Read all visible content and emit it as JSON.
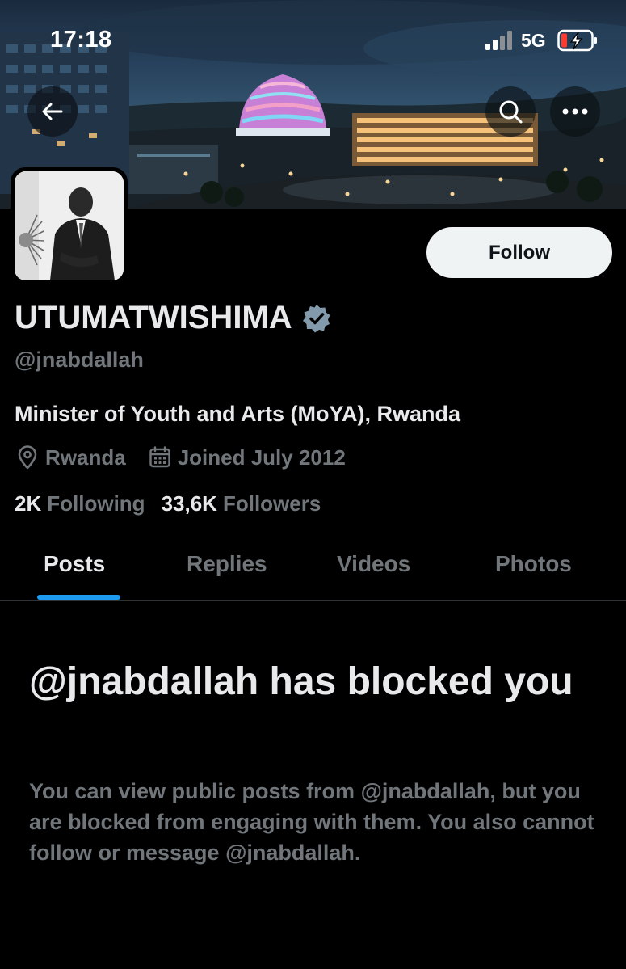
{
  "status_bar": {
    "time": "17:18",
    "network": "5G",
    "icons": [
      "signal-icon",
      "battery-charging-icon"
    ]
  },
  "nav": {
    "icons": [
      "back-arrow-icon",
      "search-icon",
      "more-icon"
    ]
  },
  "profile": {
    "display_name": "UTUMATWISHIMA",
    "verified": true,
    "handle": "@jnabdallah",
    "bio": "Minister of Youth and Arts (MoYA), Rwanda",
    "location": "Rwanda",
    "joined": "Joined July 2012",
    "following_count": "2K",
    "following_label": "Following",
    "followers_count": "33,6K",
    "followers_label": "Followers",
    "follow_label": "Follow"
  },
  "tabs": [
    {
      "label": "Posts",
      "active": true
    },
    {
      "label": "Replies",
      "active": false
    },
    {
      "label": "Videos",
      "active": false
    },
    {
      "label": "Photos",
      "active": false
    }
  ],
  "blocked": {
    "title": "@jnabdallah has blocked you",
    "body": "You can view public posts from @jnabdallah, but you are blocked from engaging with them. You also cannot follow or message @jnabdallah."
  },
  "colors": {
    "background": "#000000",
    "primary_text": "#e7e9ea",
    "secondary_text": "#71767b",
    "accent": "#1d9bf0",
    "follow_button": "#eff3f4",
    "verified_badge": "#829aab"
  }
}
